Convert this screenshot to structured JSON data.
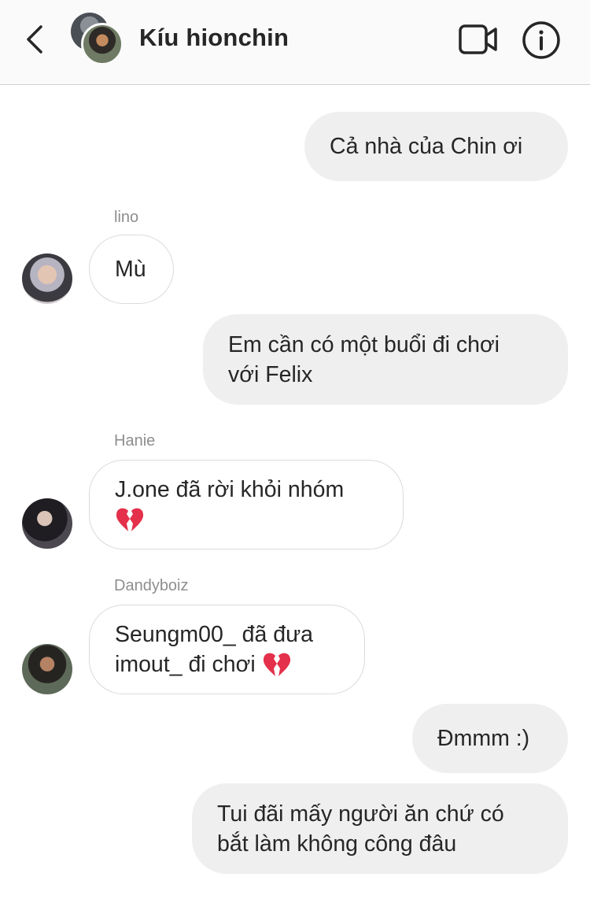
{
  "header": {
    "title": "Kíu hionchin",
    "icons": {
      "back": "chevron-left-icon",
      "video": "video-camera-icon",
      "info": "info-icon"
    }
  },
  "messages": [
    {
      "direction": "out",
      "text": "Cả nhà của Chin ơi"
    },
    {
      "direction": "in",
      "sender": "lino",
      "text": "Mù"
    },
    {
      "direction": "out",
      "text": "Em cần có một buổi đi chơi\nvới Felix"
    },
    {
      "direction": "in",
      "sender": "Hanie",
      "text": "J.one đã rời khỏi nhóm",
      "emoji": "broken-heart"
    },
    {
      "direction": "in",
      "sender": "Dandyboiz",
      "text_line1": "Seungm00_ đã đưa",
      "text_line2": "imout_ đi chơi",
      "emoji": "broken-heart"
    },
    {
      "direction": "out",
      "text": "Đmmm :)"
    },
    {
      "direction": "out",
      "text": "Tui đãi mấy người ăn chứ có\nbắt làm không công đâu"
    }
  ],
  "colors": {
    "header_bg": "#fafafa",
    "outgoing_bubble": "#efefef",
    "incoming_border": "#dbdbdb",
    "sender_name": "#8e8e8e",
    "text": "#262626",
    "heart": "#e4304a"
  }
}
